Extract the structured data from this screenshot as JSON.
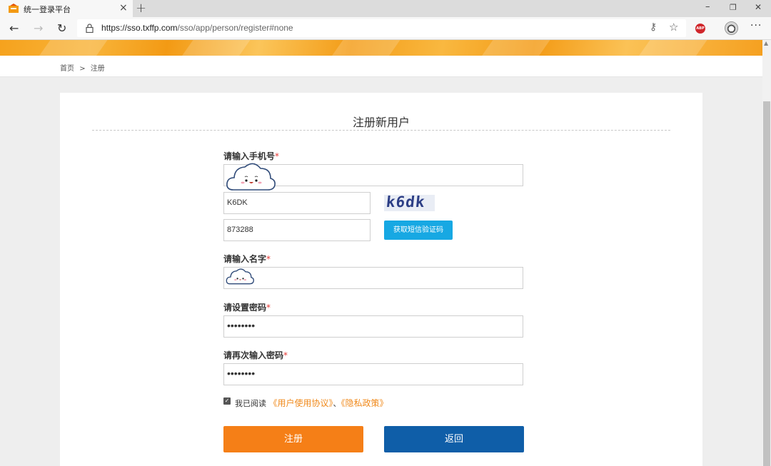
{
  "browser": {
    "tab_title": "统一登录平台",
    "tab_close": "×",
    "new_tab": "+",
    "url_host": "https://sso.txffp.com",
    "url_path": "/sso/app/person/register#none",
    "window_minimize": "–",
    "window_restore": "❐",
    "window_close": "✕",
    "back": "←",
    "forward": "→",
    "refresh": "↻",
    "lock": "🔒",
    "key": "⚷",
    "favorite": "☆",
    "extension_label": "ABP",
    "menu": "···"
  },
  "breadcrumb": {
    "home": "首页",
    "separator": ">",
    "current": "注册"
  },
  "form": {
    "title": "注册新用户",
    "phone_label": "请输入手机号",
    "phone_value": "",
    "captcha_value": "K6DK",
    "captcha_image_text": "k6dk",
    "sms_code_value": "873288",
    "sms_button": "获取短信验证码",
    "name_label": "请输入名字",
    "name_value": "",
    "password_label": "请设置密码",
    "password_value": "••••••••",
    "confirm_label": "请再次输入密码",
    "confirm_value": "••••••••",
    "required_mark": "*",
    "agree_checked": true,
    "agree_check": "✓",
    "agree_prefix": "我已阅读",
    "user_agreement": "《用户使用协议》",
    "agree_sep": "、",
    "privacy_policy": "《隐私政策》",
    "register_button": "注册",
    "back_button": "返回"
  },
  "colors": {
    "primary_orange": "#f57f17",
    "primary_blue": "#0f5ea8",
    "sms_button": "#17a8e3",
    "link": "#f08a1c"
  }
}
